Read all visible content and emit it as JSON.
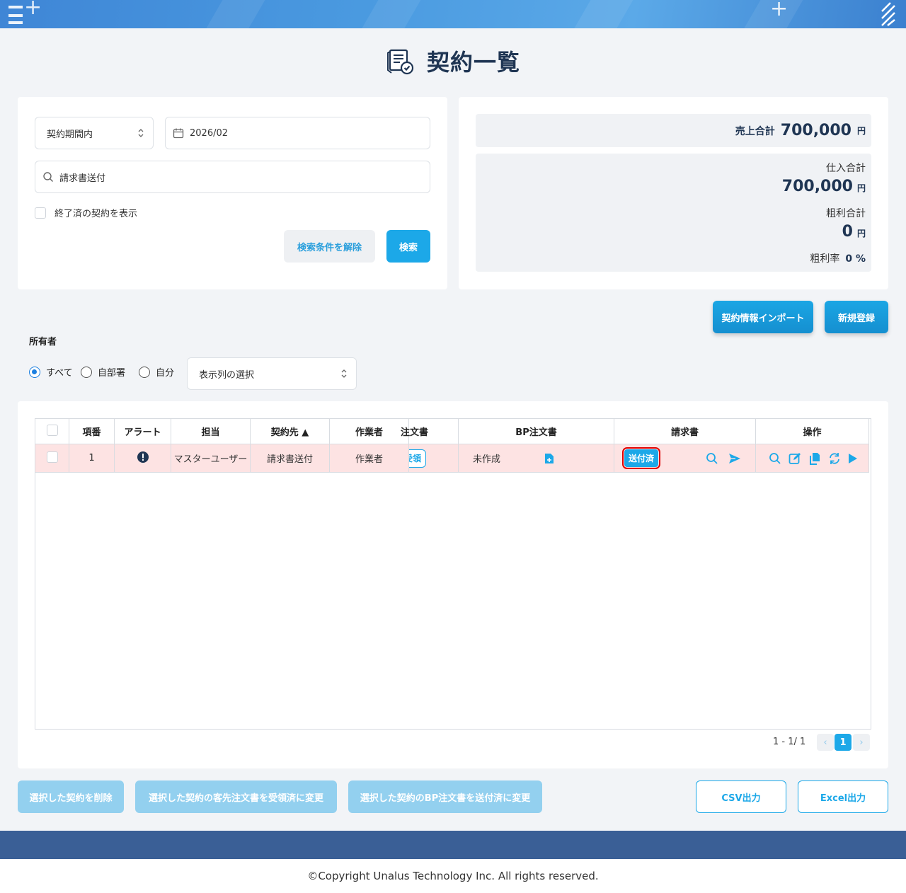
{
  "page": {
    "title": "契約一覧"
  },
  "search": {
    "period_select": "契約期間内",
    "month_value": "2026/02",
    "keyword_value": "請求書送付",
    "show_finished_label": "終了済の契約を表示",
    "clear_label": "検索条件を解除",
    "search_label": "検索"
  },
  "summary": {
    "sales_label": "売上合計",
    "sales_value": "700,000",
    "purchase_label": "仕入合計",
    "purchase_value": "700,000",
    "profit_label": "粗利合計",
    "profit_value": "0",
    "rate_label": "粗利率",
    "rate_value": "0 %",
    "unit": "円"
  },
  "actions": {
    "import_label": "契約情報インポート",
    "new_label": "新規登録"
  },
  "owner": {
    "label": "所有者",
    "options": [
      "すべて",
      "自部署",
      "自分"
    ],
    "selected": "すべて",
    "columns_select": "表示列の選択"
  },
  "table": {
    "headers": [
      "項番",
      "アラート",
      "担当",
      "契約先 ▲",
      "作業者",
      "注文書",
      "BP注文書",
      "請求書",
      "操作"
    ],
    "rows": [
      {
        "no": "1",
        "owner": "マスターユーザー",
        "client": "請求書送付",
        "worker": "作業者",
        "order_status": "受領",
        "bp_status": "未作成",
        "invoice_status": "送付済"
      }
    ]
  },
  "pager": {
    "range": "1 - 1/ 1",
    "current": "1",
    "prev": "‹",
    "next": "›"
  },
  "bulk": {
    "delete_label": "選択した契約を削除",
    "order_received_label": "選択した契約の客先注文書を受領済に変更",
    "bp_sent_label": "選択した契約のBP注文書を送付済に変更",
    "csv_label": "CSV出力",
    "excel_label": "Excel出力"
  },
  "footer": {
    "copyright": "©Copyright Unalus Technology Inc. All rights reserved."
  },
  "colors": {
    "accent": "#1ca8e8",
    "row_alert": "#fde3e3",
    "title": "#1f3553",
    "footer_band": "#3a5f96"
  }
}
